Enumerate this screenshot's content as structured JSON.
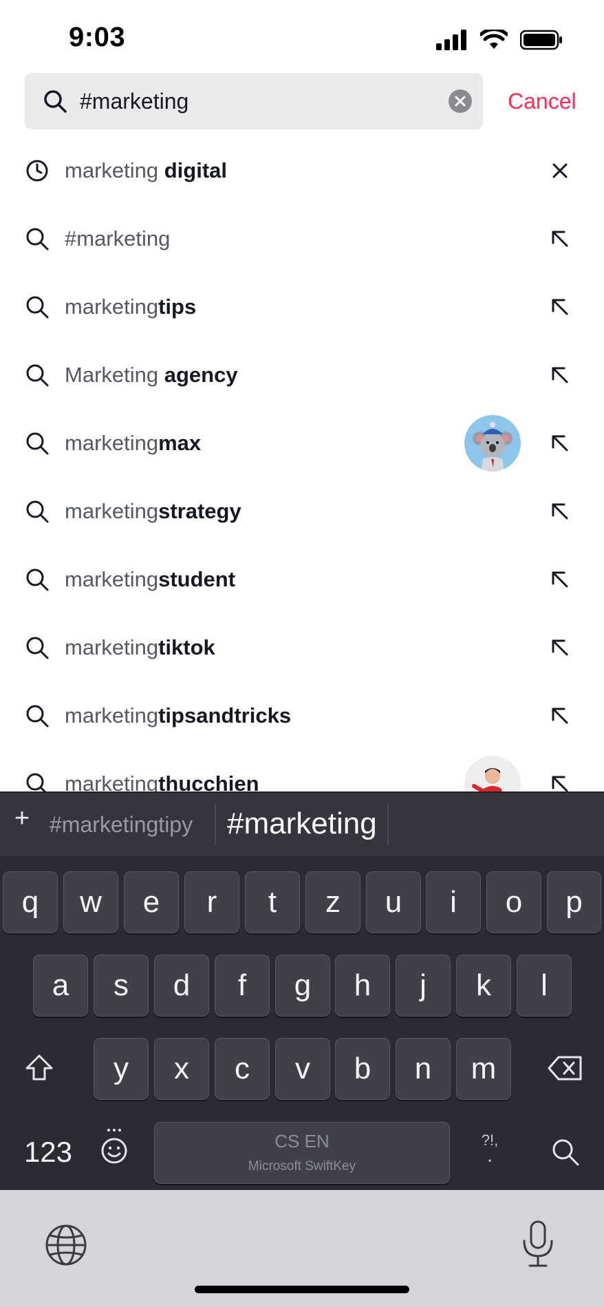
{
  "status_bar": {
    "time": "9:03"
  },
  "search": {
    "query": "#marketing",
    "cancel_label": "Cancel"
  },
  "suggestions": [
    {
      "type": "history",
      "prefix": "marketing ",
      "suffix": "digital",
      "action": "remove"
    },
    {
      "type": "search",
      "prefix": "#marketing",
      "suffix": "",
      "action": "fill"
    },
    {
      "type": "search",
      "prefix": "marketing",
      "suffix": "tips",
      "action": "fill"
    },
    {
      "type": "search",
      "prefix": "Marketing ",
      "suffix": "agency",
      "action": "fill"
    },
    {
      "type": "search",
      "prefix": "marketing",
      "suffix": "max",
      "action": "fill",
      "avatar": "koala-avatar"
    },
    {
      "type": "search",
      "prefix": "marketing",
      "suffix": "strategy",
      "action": "fill"
    },
    {
      "type": "search",
      "prefix": "marketing",
      "suffix": "student",
      "action": "fill"
    },
    {
      "type": "search",
      "prefix": "marketing",
      "suffix": "tiktok",
      "action": "fill"
    },
    {
      "type": "search",
      "prefix": "marketing",
      "suffix": "tipsandtricks",
      "action": "fill"
    },
    {
      "type": "search",
      "prefix": "marketing",
      "suffix": "thucchien",
      "action": "fill",
      "avatar": "person-avatar"
    }
  ],
  "keyboard": {
    "predictions": {
      "left": "#marketingtipy",
      "center": "#marketing"
    },
    "row1": [
      "q",
      "w",
      "e",
      "r",
      "t",
      "z",
      "u",
      "i",
      "o",
      "p"
    ],
    "row2": [
      "a",
      "s",
      "d",
      "f",
      "g",
      "h",
      "j",
      "k",
      "l"
    ],
    "row3": [
      "y",
      "x",
      "c",
      "v",
      "b",
      "n",
      "m"
    ],
    "numbers_label": "123",
    "punct_label": "?!,",
    "space_label": "CS EN",
    "space_brand": "Microsoft SwiftKey",
    "icons": [
      "shift-icon",
      "backspace-icon",
      "emoji-icon",
      "search-key-icon",
      "globe-icon",
      "microphone-icon"
    ]
  },
  "colors": {
    "accent": "#fe2c55",
    "text_primary": "#161823",
    "text_secondary": "#555862",
    "keyboard_bg": "#2b2c33",
    "key_bg": "#3f4048"
  }
}
